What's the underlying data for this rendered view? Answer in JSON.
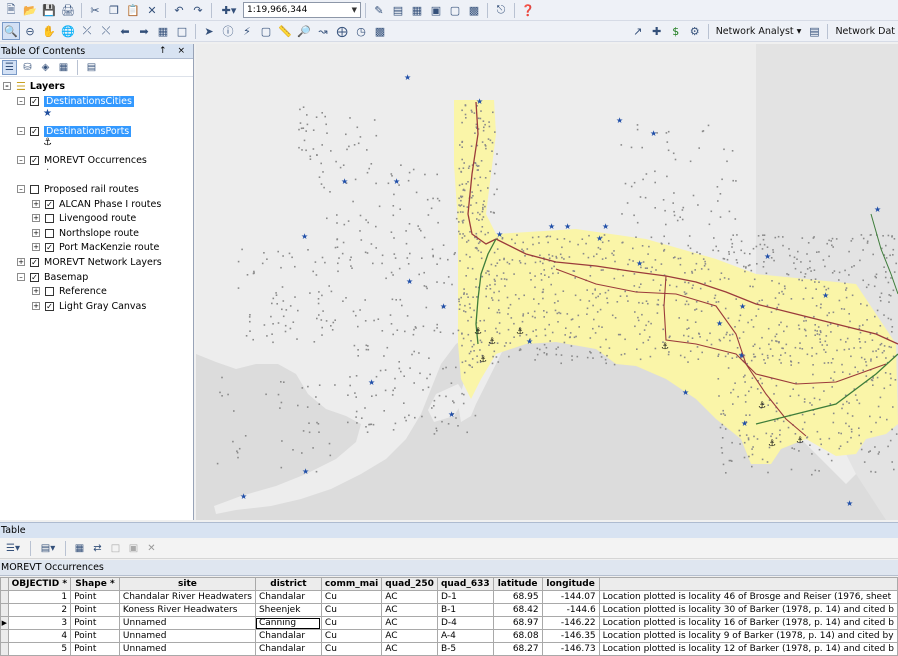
{
  "toolbar": {
    "scale_value": "1:19,966,344",
    "network_analyst_label": "Network Analyst ▾",
    "network_dataset_label": "Network Dat"
  },
  "toc": {
    "title": "Table Of Contents",
    "controls": "↑ ×",
    "root_label": "Layers",
    "layers": [
      {
        "label": "DestinationsCities",
        "checked": true,
        "selected": true
      },
      {
        "label": "DestinationsPorts",
        "checked": true,
        "selected": true
      },
      {
        "label": "MOREVT Occurrences",
        "checked": true
      },
      {
        "label": "Proposed rail routes",
        "checked": false
      },
      {
        "label": "ALCAN Phase I routes",
        "checked": true
      },
      {
        "label": "Livengood route",
        "checked": false
      },
      {
        "label": "Northslope route",
        "checked": false
      },
      {
        "label": "Port MacKenzie route",
        "checked": true
      },
      {
        "label": "MOREVT Network Layers",
        "checked": true
      },
      {
        "label": "Basemap",
        "checked": true
      },
      {
        "label": "Reference",
        "checked": false
      },
      {
        "label": "Light Gray Canvas",
        "checked": true
      }
    ]
  },
  "map": {
    "colors": {
      "water": "#dcdcdc",
      "land": "#ececec",
      "canada": "#e2e2e2",
      "buffer": "#fbf6a4",
      "occurrence": "#8a8a8a",
      "city_star": "#1f4ea8",
      "route_red": "#9b3b3b",
      "route_green": "#3e7d3a"
    }
  },
  "table": {
    "window_title": "Table",
    "tab_label": "MOREVT Occurrences",
    "columns": [
      "OBJECTID *",
      "Shape *",
      "site",
      "district",
      "comm_mai",
      "quad_250",
      "quad_633",
      "latitude",
      "longitude",
      ""
    ],
    "rows": [
      [
        "1",
        "Point",
        "Chandalar River Headwaters",
        "Chandalar",
        "Cu",
        "AC",
        "D-1",
        "68.95",
        "-144.07",
        "Location plotted is locality 46 of Brosge and Reiser (1976, sheet"
      ],
      [
        "2",
        "Point",
        "Koness River Headwaters",
        "Sheenjek",
        "Cu",
        "AC",
        "B-1",
        "68.42",
        "-144.6",
        "Location plotted is locality 30 of Barker (1978, p. 14) and cited b"
      ],
      [
        "3",
        "Point",
        "Unnamed",
        "Canning",
        "Cu",
        "AC",
        "D-4",
        "68.97",
        "-146.22",
        "Location plotted is locality 16 of Barker (1978, p. 14) and cited b"
      ],
      [
        "4",
        "Point",
        "Unnamed",
        "Chandalar",
        "Cu",
        "AC",
        "A-4",
        "68.08",
        "-146.35",
        "Location plotted is locality 9 of Barker (1978, p. 14) and cited by"
      ],
      [
        "5",
        "Point",
        "Unnamed",
        "Chandalar",
        "Cu",
        "AC",
        "B-5",
        "68.27",
        "-146.73",
        "Location plotted is locality 12 of Barker (1978, p. 14) and cited b"
      ]
    ],
    "current_row_index": 2
  }
}
